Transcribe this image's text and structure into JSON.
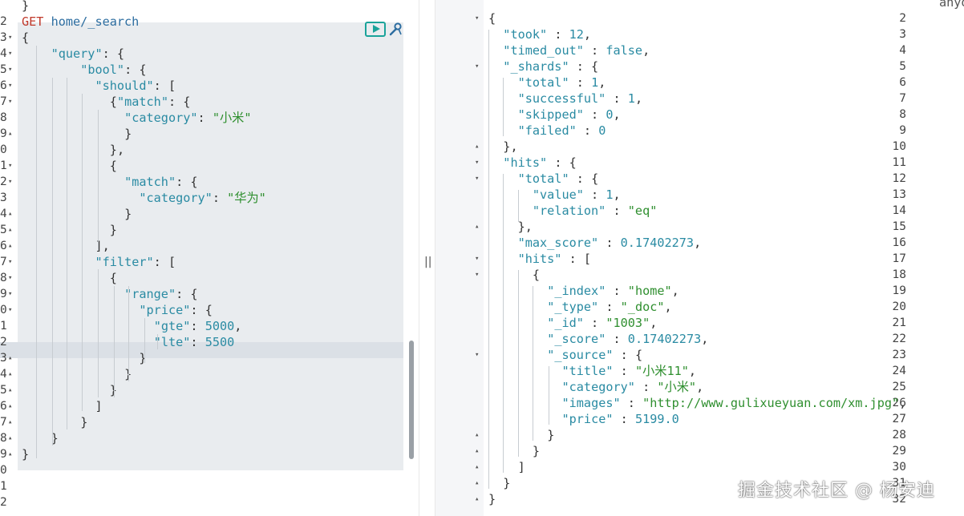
{
  "request": {
    "method": "GET",
    "url": "home/_search",
    "lines": [
      {
        "n": "",
        "t": "}"
      },
      {
        "n": "2",
        "t": ""
      },
      {
        "n": "3",
        "t": "{"
      },
      {
        "n": "4",
        "t": "\"query\": {"
      },
      {
        "n": "5",
        "t": "\"bool\": {"
      },
      {
        "n": "6",
        "t": "\"should\": ["
      },
      {
        "n": "7",
        "t": "{\"match\": {"
      },
      {
        "n": "8",
        "t": "\"category\": \"小米\""
      },
      {
        "n": "9",
        "t": "}"
      },
      {
        "n": "0",
        "t": "},"
      },
      {
        "n": "1",
        "t": "{"
      },
      {
        "n": "2",
        "t": "\"match\": {"
      },
      {
        "n": "3",
        "t": "\"category\": \"华为\""
      },
      {
        "n": "4",
        "t": "}"
      },
      {
        "n": "5",
        "t": "}"
      },
      {
        "n": "6",
        "t": "],"
      },
      {
        "n": "7",
        "t": "\"filter\": ["
      },
      {
        "n": "8",
        "t": "{"
      },
      {
        "n": "9",
        "t": "\"range\": {"
      },
      {
        "n": "0",
        "t": "\"price\": {"
      },
      {
        "n": "1",
        "t": "\"gte\": 5000,"
      },
      {
        "n": "2",
        "t": "\"lte\": 5500"
      },
      {
        "n": "3",
        "t": "}"
      },
      {
        "n": "4",
        "t": "}"
      },
      {
        "n": "5",
        "t": "}"
      },
      {
        "n": "6",
        "t": "]"
      },
      {
        "n": "7",
        "t": "}"
      },
      {
        "n": "8",
        "t": "}"
      },
      {
        "n": "9",
        "t": "}"
      },
      {
        "n": "0",
        "t": ""
      },
      {
        "n": "1",
        "t": ""
      },
      {
        "n": "2",
        "t": ""
      }
    ]
  },
  "response": {
    "top_comment": "anyone. See https://www.elastic.co/guide/en/elasticsearch/re",
    "lines": [
      {
        "n": "2",
        "t": "{"
      },
      {
        "n": "3",
        "t": "\"took\" : 12,"
      },
      {
        "n": "4",
        "t": "\"timed_out\" : false,"
      },
      {
        "n": "5",
        "t": "\"_shards\" : {"
      },
      {
        "n": "6",
        "t": "\"total\" : 1,"
      },
      {
        "n": "7",
        "t": "\"successful\" : 1,"
      },
      {
        "n": "8",
        "t": "\"skipped\" : 0,"
      },
      {
        "n": "9",
        "t": "\"failed\" : 0"
      },
      {
        "n": "10",
        "t": "},"
      },
      {
        "n": "11",
        "t": "\"hits\" : {"
      },
      {
        "n": "12",
        "t": "\"total\" : {"
      },
      {
        "n": "13",
        "t": "\"value\" : 1,"
      },
      {
        "n": "14",
        "t": "\"relation\" : \"eq\""
      },
      {
        "n": "15",
        "t": "},"
      },
      {
        "n": "16",
        "t": "\"max_score\" : 0.17402273,"
      },
      {
        "n": "17",
        "t": "\"hits\" : ["
      },
      {
        "n": "18",
        "t": "{"
      },
      {
        "n": "19",
        "t": "\"_index\" : \"home\","
      },
      {
        "n": "20",
        "t": "\"_type\" : \"_doc\","
      },
      {
        "n": "21",
        "t": "\"_id\" : \"1003\","
      },
      {
        "n": "22",
        "t": "\"_score\" : 0.17402273,"
      },
      {
        "n": "23",
        "t": "\"_source\" : {"
      },
      {
        "n": "24",
        "t": "\"title\" : \"小米11\","
      },
      {
        "n": "25",
        "t": "\"category\" : \"小米\","
      },
      {
        "n": "26",
        "t": "\"images\" : \"http://www.gulixueyuan.com/xm.jpg\","
      },
      {
        "n": "27",
        "t": "\"price\" : 5199.0"
      },
      {
        "n": "28",
        "t": "}"
      },
      {
        "n": "29",
        "t": "}"
      },
      {
        "n": "30",
        "t": "]"
      },
      {
        "n": "31",
        "t": "}"
      },
      {
        "n": "32",
        "t": "}"
      }
    ]
  },
  "divider_label": "||",
  "watermark": "掘金技术社区 @ 杨安迪",
  "icons": {
    "run": "play-icon",
    "wrench": "wrench-icon"
  },
  "colors": {
    "accent": "#1aa39a",
    "method": "#c0392b"
  }
}
